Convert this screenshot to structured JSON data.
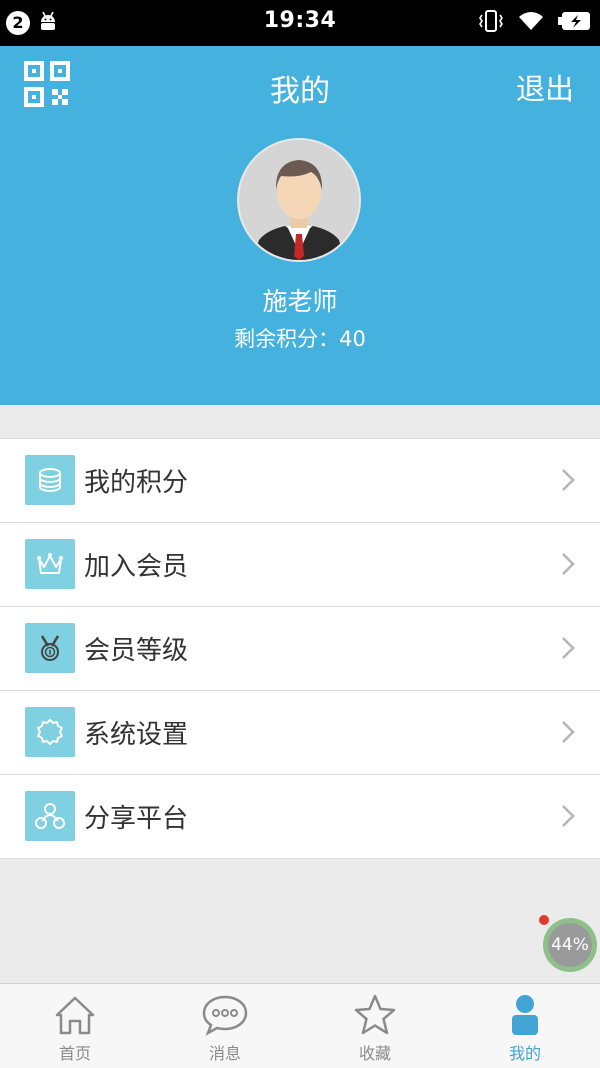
{
  "status_bar": {
    "notification_count": "2",
    "time": "19:34"
  },
  "header": {
    "title": "我的",
    "logout_label": "退出",
    "user_name": "施老师",
    "points_label": "剩余积分：40"
  },
  "menu": {
    "items": [
      {
        "label": "我的积分",
        "icon": "coins-stack-icon"
      },
      {
        "label": "加入会员",
        "icon": "crown-icon"
      },
      {
        "label": "会员等级",
        "icon": "medal-icon"
      },
      {
        "label": "系统设置",
        "icon": "gear-icon"
      },
      {
        "label": "分享平台",
        "icon": "share-people-icon"
      }
    ]
  },
  "floating_widget": {
    "percent": "44%"
  },
  "tabbar": {
    "tabs": [
      {
        "label": "首页",
        "icon": "home-icon"
      },
      {
        "label": "消息",
        "icon": "chat-bubble-icon"
      },
      {
        "label": "收藏",
        "icon": "star-icon"
      },
      {
        "label": "我的",
        "icon": "person-icon",
        "active": true
      }
    ]
  },
  "colors": {
    "header_bg": "#44b1de",
    "menu_icon_bg": "#7fd0e0",
    "active_tab": "#43a5d6"
  }
}
